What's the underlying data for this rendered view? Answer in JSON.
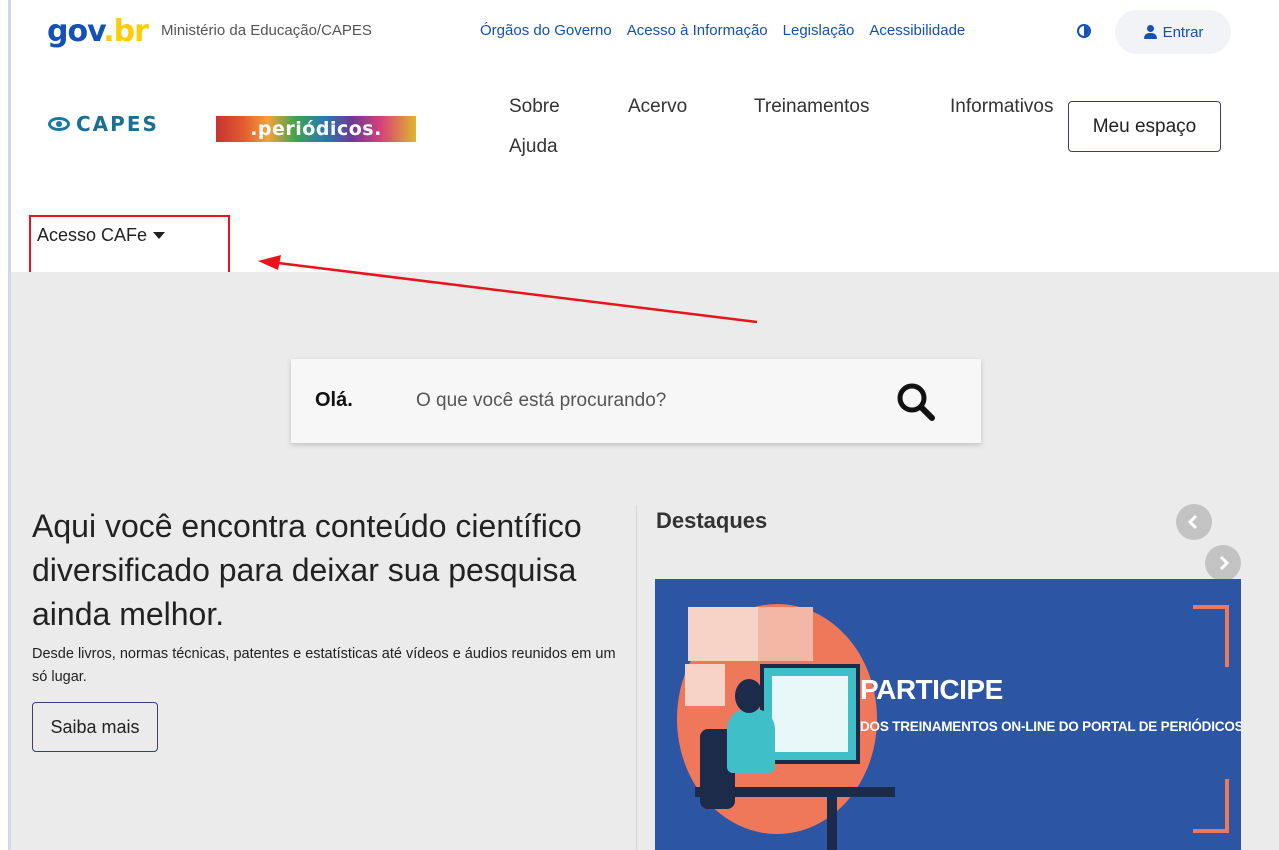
{
  "gov_bar": {
    "logo_text_gov": "gov",
    "logo_text_br": ".br",
    "ministry": "Ministério da Educação/CAPES",
    "links": [
      "Órgãos do Governo",
      "Acesso à Informação",
      "Legislação",
      "Acessibilidade"
    ],
    "contrast_icon": "contrast-icon",
    "login_label": "Entrar",
    "login_icon": "user-icon"
  },
  "header": {
    "capes_logo_text": "CAPES",
    "periodicos_logo_text": ".periódicos.",
    "nav": [
      "Sobre",
      "Acervo",
      "Treinamentos",
      "Informativos",
      "Ajuda"
    ],
    "my_space_label": "Meu espaço",
    "access_menu_label": "Acesso CAFe"
  },
  "search": {
    "greeting": "Olá.",
    "placeholder": "O que você está procurando?",
    "icon": "search-icon"
  },
  "intro": {
    "headline": "Aqui você encontra conteúdo científico diversificado para deixar sua pesquisa ainda melhor.",
    "description": "Desde livros, normas técnicas, patentes e estatísticas até vídeos e áudios reunidos em um só lugar.",
    "cta_label": "Saiba mais"
  },
  "highlights": {
    "title": "Destaques",
    "banner_title": "PARTICIPE",
    "banner_subtitle": "DOS TREINAMENTOS ON-LINE DO PORTAL DE PERIÓDICOS"
  },
  "colors": {
    "gov_blue": "#1351b4",
    "annotation_red": "#e8141b",
    "banner_blue": "#2c55a3",
    "banner_accent": "#f0785a"
  }
}
